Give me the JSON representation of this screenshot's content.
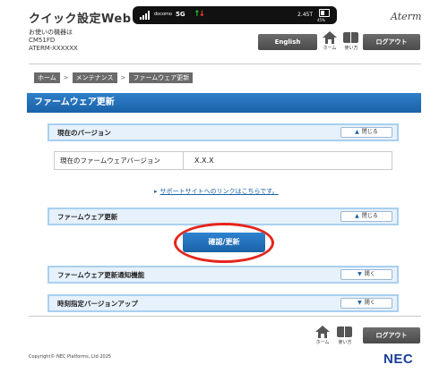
{
  "header": {
    "title": "クイック設定Web",
    "device_info": [
      "お使いの機器は",
      "CM51FD",
      "ATERM-XXXXXX"
    ],
    "brand": "Aterm",
    "english_label": "English",
    "home_label": "ホーム",
    "manual_label": "使い方",
    "logout_label": "ログアウト"
  },
  "status": {
    "carrier": "docomo",
    "network": "5G",
    "data": "2.45T",
    "battery": "45%"
  },
  "breadcrumb": {
    "items": [
      "ホーム",
      "メンテナンス",
      "ファームウェア更新"
    ],
    "separator": ">"
  },
  "page": {
    "title": "ファームウェア更新"
  },
  "sections": {
    "current_version": {
      "title": "現在のバージョン",
      "toggle": "閉じる"
    },
    "firmware_update": {
      "title": "ファームウェア更新",
      "toggle": "閉じる"
    },
    "update_notice": {
      "title": "ファームウェア更新通知機能",
      "toggle": "開く"
    },
    "scheduled_update": {
      "title": "時刻指定バージョンアップ",
      "toggle": "開く"
    }
  },
  "version_table": {
    "label": "現在のファームウェアバージョン",
    "value": "X.X.X"
  },
  "support_link": "サポートサイトへのリンクはこちらです。",
  "confirm_button": "確認/更新",
  "footer": {
    "home_label": "ホーム",
    "manual_label": "使い方",
    "logout_label": "ログアウト",
    "copyright": "Copyright© NEC Platforms, Ltd 2025",
    "logo": "NEC"
  },
  "colors": {
    "accent": "#1a62a8",
    "section_bg": "#e6f1fb",
    "section_border": "#a8d0f0",
    "highlight": "#e5261c",
    "dark_button": "#555555"
  }
}
